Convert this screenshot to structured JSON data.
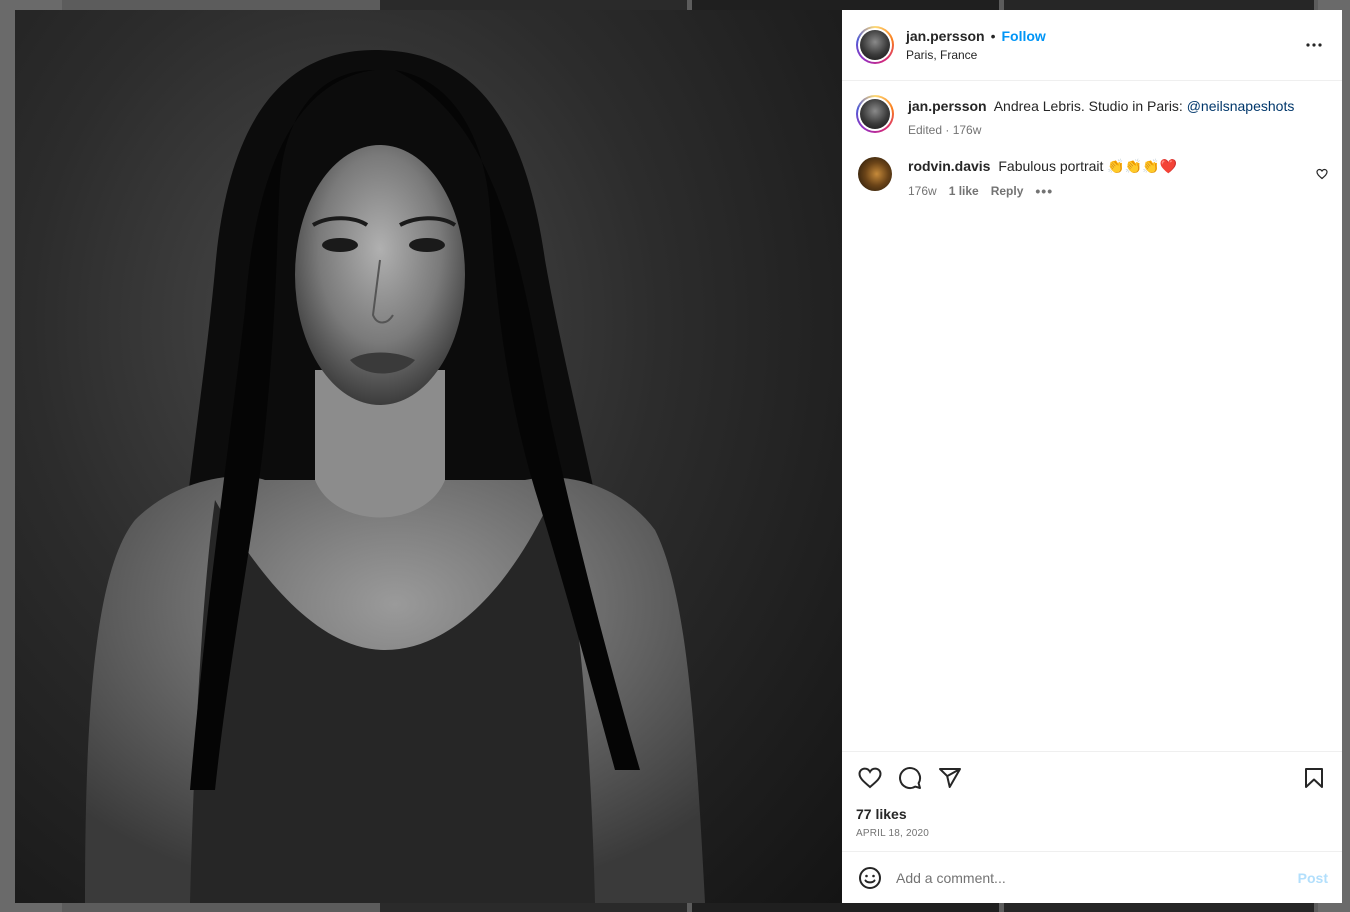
{
  "post": {
    "author": "jan.persson",
    "location": "Paris, France",
    "follow_label": "Follow",
    "separator": "•",
    "caption": {
      "author": "jan.persson",
      "text": "Andrea Lebris. Studio in Paris: ",
      "mention": "@neilsnapeshots",
      "meta": "Edited · 176w"
    },
    "comments": [
      {
        "author": "rodvin.davis",
        "text": "Fabulous portrait 👏👏👏❤️",
        "age": "176w",
        "likes": "1 like",
        "reply_label": "Reply",
        "more": "•••"
      }
    ],
    "likes": "77 likes",
    "date": "APRIL 18, 2020",
    "add_comment_placeholder": "Add a comment...",
    "post_label": "Post"
  },
  "colors": {
    "accent": "#0095f6",
    "mention": "#00376b",
    "post_disabled": "#b2dffc",
    "text": "#262626",
    "muted": "#737373"
  },
  "icons": [
    "more-horizontal-icon",
    "heart-icon",
    "comment-icon",
    "share-icon",
    "bookmark-icon",
    "emoji-icon",
    "small-heart-icon"
  ]
}
